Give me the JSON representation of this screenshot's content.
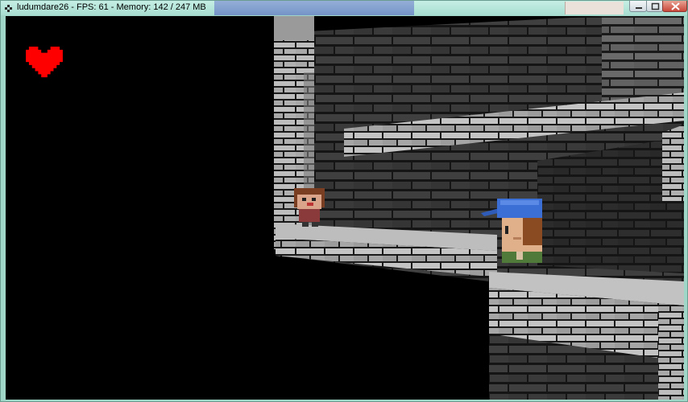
{
  "window": {
    "title": "ludumdare26 - FPS: 61 - Memory: 142 / 247 MB"
  },
  "hud": {
    "lives": 1,
    "life_icon": "heart-icon",
    "life_color": "#ff0000"
  },
  "colors": {
    "background": "#000000",
    "brick_light": "#c8c8c8",
    "brick_mid": "#8a8a8a",
    "brick_dark": "#3a3a3a",
    "mortar": "#151515",
    "hat_blue": "#3b6fd6",
    "skin": "#e0b08a",
    "hair": "#8a4a22",
    "shirt_green": "#4f7a3a"
  }
}
